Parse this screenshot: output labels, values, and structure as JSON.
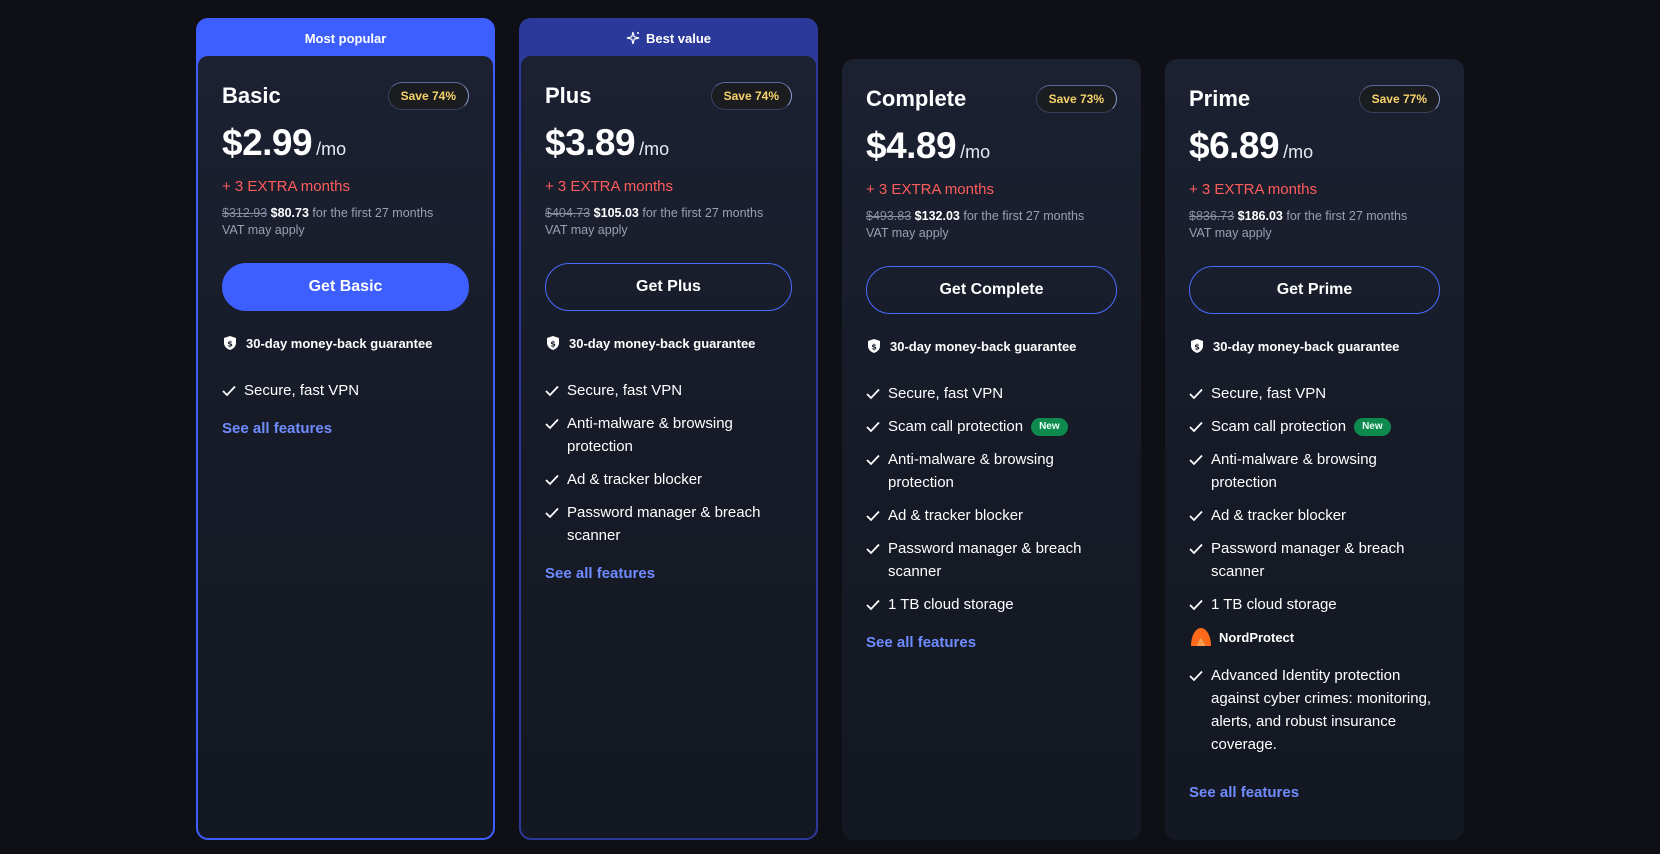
{
  "colors": {
    "accent": "#3e5fff",
    "extra": "#ff5c5c",
    "save": "#f6d36a",
    "new_badge": "#0f8a4e",
    "link": "#6f8cff",
    "page_bg": "#0e1015"
  },
  "plans": [
    {
      "ribbon": "Most popular",
      "name": "Basic",
      "save": "Save 74%",
      "price": "$2.99",
      "per": "/mo",
      "extra": "+ 3 EXTRA months",
      "old_price": "$312.93",
      "new_price": "$80.73",
      "term": "for the first 27 months",
      "vat": "VAT may apply",
      "cta": "Get Basic",
      "guarantee": "30-day money-back guarantee",
      "features": [
        "Secure, fast VPN"
      ],
      "see_all": "See all features"
    },
    {
      "ribbon": "Best value",
      "name": "Plus",
      "save": "Save 74%",
      "price": "$3.89",
      "per": "/mo",
      "extra": "+ 3 EXTRA months",
      "old_price": "$404.73",
      "new_price": "$105.03",
      "term": "for the first 27 months",
      "vat": "VAT may apply",
      "cta": "Get Plus",
      "guarantee": "30-day money-back guarantee",
      "features": [
        "Secure, fast VPN",
        "Anti-malware & browsing protection",
        "Ad & tracker blocker",
        "Password manager & breach scanner"
      ],
      "see_all": "See all features"
    },
    {
      "name": "Complete",
      "save": "Save 73%",
      "price": "$4.89",
      "per": "/mo",
      "extra": "+ 3 EXTRA months",
      "old_price": "$493.83",
      "new_price": "$132.03",
      "term": "for the first 27 months",
      "vat": "VAT may apply",
      "cta": "Get Complete",
      "guarantee": "30-day money-back guarantee",
      "features": [
        "Secure, fast VPN",
        "Scam call protection",
        "Anti-malware & browsing protection",
        "Ad & tracker blocker",
        "Password manager & breach scanner",
        "1 TB cloud storage"
      ],
      "new_label": "New",
      "see_all": "See all features"
    },
    {
      "name": "Prime",
      "save": "Save 77%",
      "price": "$6.89",
      "per": "/mo",
      "extra": "+ 3 EXTRA months",
      "old_price": "$836.73",
      "new_price": "$186.03",
      "term": "for the first 27 months",
      "vat": "VAT may apply",
      "cta": "Get Prime",
      "guarantee": "30-day money-back guarantee",
      "features": [
        "Secure, fast VPN",
        "Scam call protection",
        "Anti-malware & browsing protection",
        "Ad & tracker blocker",
        "Password manager & breach scanner",
        "1 TB cloud storage"
      ],
      "new_label": "New",
      "nordprotect": "NordProtect",
      "extra_feature": "Advanced Identity protection against cyber crimes: monitoring, alerts, and robust insurance coverage.",
      "see_all": "See all features"
    }
  ]
}
